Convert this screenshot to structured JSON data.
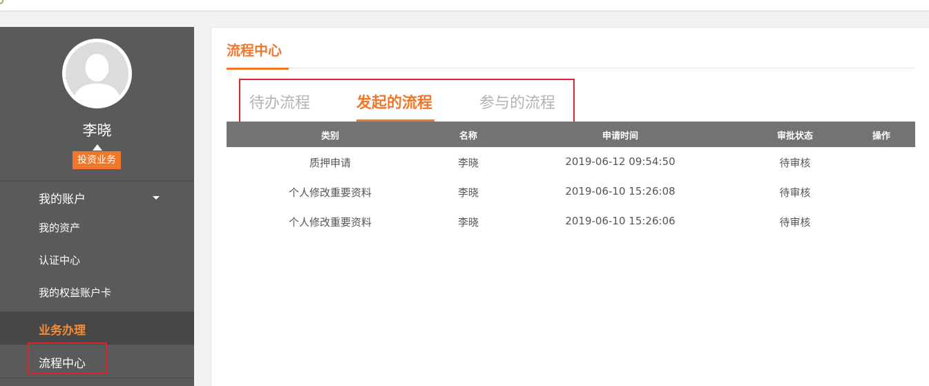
{
  "sidebar": {
    "user_name": "李晓",
    "role_badge": "投资业务",
    "account_menu": {
      "label": "我的账户",
      "items": [
        "我的资产",
        "认证中心",
        "我的权益账户卡"
      ]
    },
    "business_section": "业务办理",
    "active_item": "流程中心"
  },
  "main": {
    "title": "流程中心",
    "tabs": [
      {
        "label": "待办流程",
        "active": false
      },
      {
        "label": "发起的流程",
        "active": true
      },
      {
        "label": "参与的流程",
        "active": false
      }
    ],
    "table": {
      "columns": [
        "类别",
        "名称",
        "申请时间",
        "审批状态",
        "操作"
      ],
      "rows": [
        [
          "质押申请",
          "李晓",
          "2019-06-12 09:54:50",
          "待审核",
          ""
        ],
        [
          "个人修改重要资料",
          "李晓",
          "2019-06-10 15:26:08",
          "待审核",
          ""
        ],
        [
          "个人修改重要资料",
          "李晓",
          "2019-06-10 15:26:06",
          "待审核",
          ""
        ]
      ]
    }
  },
  "colors": {
    "accent": "#f0762a",
    "sidebar_bg": "#5a5a5a",
    "highlight_box": "#e0242b",
    "table_header_bg": "#737373"
  }
}
